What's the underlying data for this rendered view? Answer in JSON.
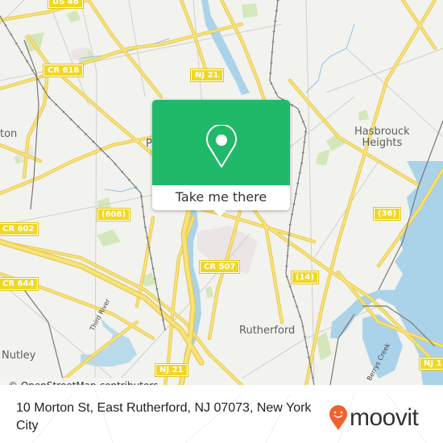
{
  "map": {
    "attribution": "© OpenStreetMap contributors",
    "road_shields": [
      {
        "id": "us46",
        "label": "US 46"
      },
      {
        "id": "cr618",
        "label": "CR 618"
      },
      {
        "id": "nj21-top",
        "label": "NJ 21"
      },
      {
        "id": "r608",
        "label": "(608)"
      },
      {
        "id": "cr602",
        "label": "CR 602"
      },
      {
        "id": "cr644",
        "label": "CR 644"
      },
      {
        "id": "cr507",
        "label": "CR 507"
      },
      {
        "id": "r14",
        "label": "(14)"
      },
      {
        "id": "r36",
        "label": "(36)"
      },
      {
        "id": "nj21-bottom",
        "label": "NJ 21"
      },
      {
        "id": "nj12x",
        "label": "NJ 1"
      }
    ],
    "places": [
      {
        "id": "hasbrouck-heights",
        "label": "Hasbrouck\nHeights",
        "line1": "Hasbrouck",
        "line2": "Heights"
      },
      {
        "id": "rutherford",
        "label": "Rutherford"
      },
      {
        "id": "nutley",
        "label": "Nutley"
      },
      {
        "id": "clifton-partial",
        "label": "ton"
      },
      {
        "id": "passaic-partial",
        "label": "P"
      }
    ],
    "streets": [
      {
        "id": "third-river",
        "label": "Third River"
      },
      {
        "id": "berrys-creek",
        "label": "Berrys Creek"
      }
    ]
  },
  "popup": {
    "icon": "location-pin-icon",
    "button_label": "Take me there",
    "color": "#20b96a"
  },
  "footer": {
    "address": "10 Morton St, East Rutherford, NJ 07073, New York City",
    "brand": "moovit",
    "brand_color": "#f0622d"
  }
}
